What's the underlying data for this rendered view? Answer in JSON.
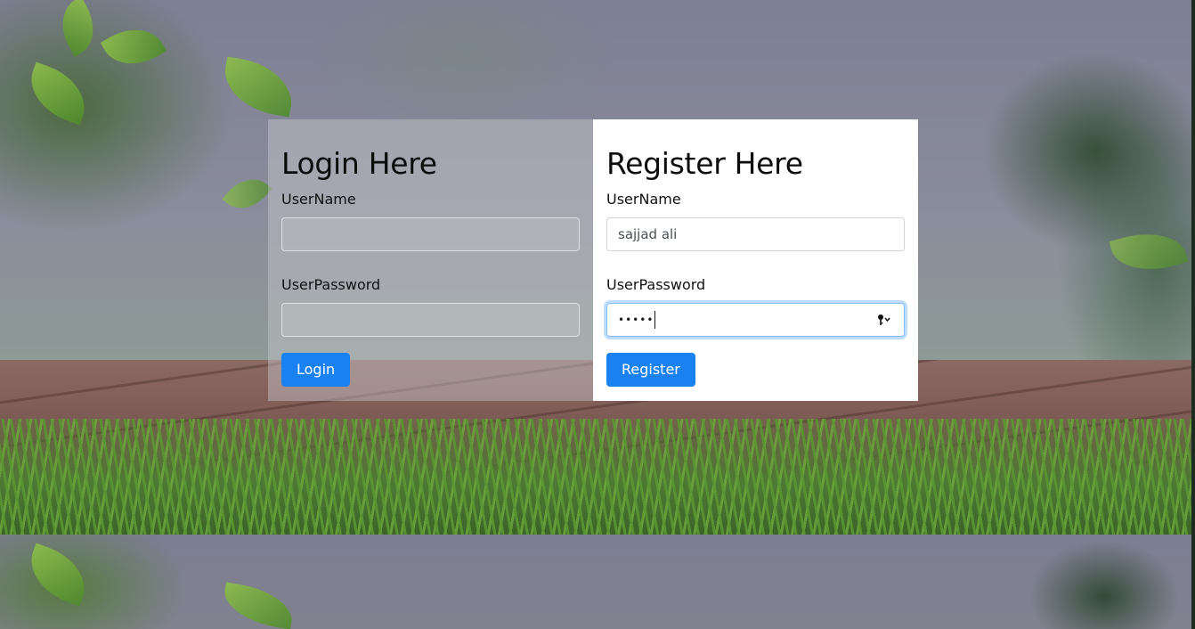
{
  "login": {
    "title": "Login Here",
    "username_label": "UserName",
    "username_value": "",
    "password_label": "UserPassword",
    "password_value": "",
    "button_label": "Login"
  },
  "register": {
    "title": "Register Here",
    "username_label": "UserName",
    "username_value": "sajjad ali",
    "password_label": "UserPassword",
    "password_masked": "•••••",
    "button_label": "Register"
  },
  "icons": {
    "password_autofill": "key-dropdown-icon"
  },
  "colors": {
    "primary_button": "#1a82f0",
    "focus_ring": "#80bdff"
  }
}
